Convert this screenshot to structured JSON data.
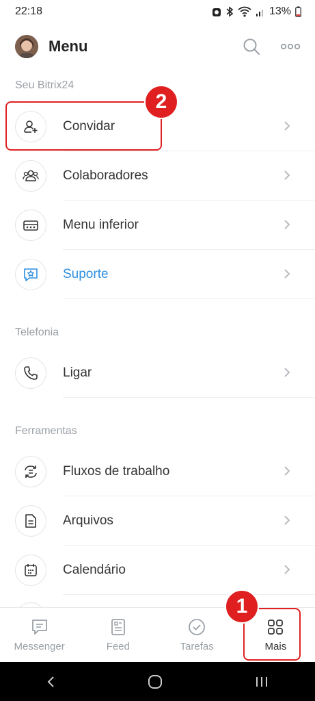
{
  "status": {
    "time": "22:18",
    "battery": "13%"
  },
  "header": {
    "title": "Menu"
  },
  "sections": {
    "bitrix": "Seu Bitrix24",
    "telefonia": "Telefonia",
    "ferramentas": "Ferramentas"
  },
  "items": {
    "convidar": "Convidar",
    "colaboradores": "Colaboradores",
    "menu_inferior": "Menu inferior",
    "suporte": "Suporte",
    "ligar": "Ligar",
    "fluxos": "Fluxos de trabalho",
    "arquivos": "Arquivos",
    "calendario": "Calendário"
  },
  "bottom_nav": {
    "messenger": "Messenger",
    "feed": "Feed",
    "tarefas": "Tarefas",
    "mais": "Mais"
  },
  "annotations": {
    "badge1": "1",
    "badge2": "2"
  },
  "colors": {
    "accent": "#2d8ee0",
    "annotation": "#e02020"
  }
}
